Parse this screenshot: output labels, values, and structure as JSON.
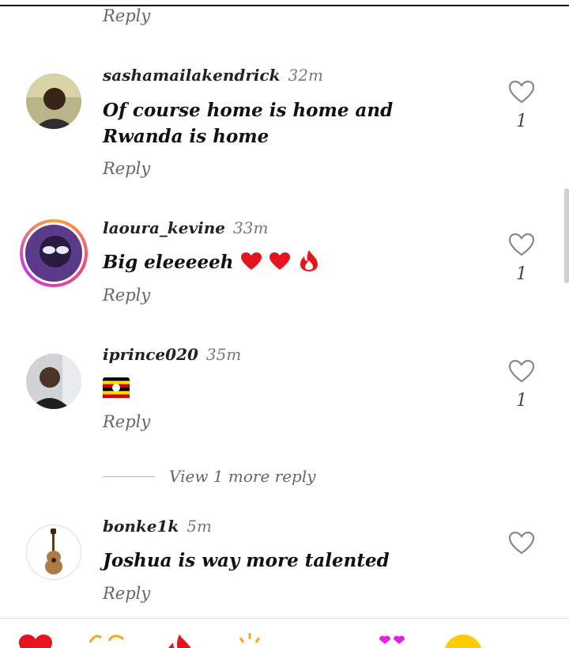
{
  "top_reply": {
    "label": "Reply"
  },
  "comments": [
    {
      "username": "sashamailakendrick",
      "time": "32m",
      "text": "Of course home is home and Rwanda is home",
      "likes": "1",
      "reply_label": "Reply"
    },
    {
      "username": "laoura_kevine",
      "time": "33m",
      "text": "Big eleeeeeh",
      "emojis": [
        "red-heart",
        "red-heart",
        "fire"
      ],
      "likes": "1",
      "reply_label": "Reply"
    },
    {
      "username": "iprince020",
      "time": "35m",
      "emoji": "uganda-flag",
      "likes": "1",
      "reply_label": "Reply"
    },
    {
      "username": "bonke1k",
      "time": "5m",
      "text": "Joshua is way more talented",
      "reply_label": "Reply"
    }
  ],
  "view_more": {
    "label": "View 1 more reply"
  },
  "quick_emojis": [
    "red-heart",
    "clapping-hands",
    "fire",
    "star-struck",
    "heart-eyes",
    "smiley"
  ],
  "colors": {
    "heart_red": "#e8141d",
    "text": "#111111",
    "muted": "#666666",
    "story_ring": "#f3447a"
  }
}
